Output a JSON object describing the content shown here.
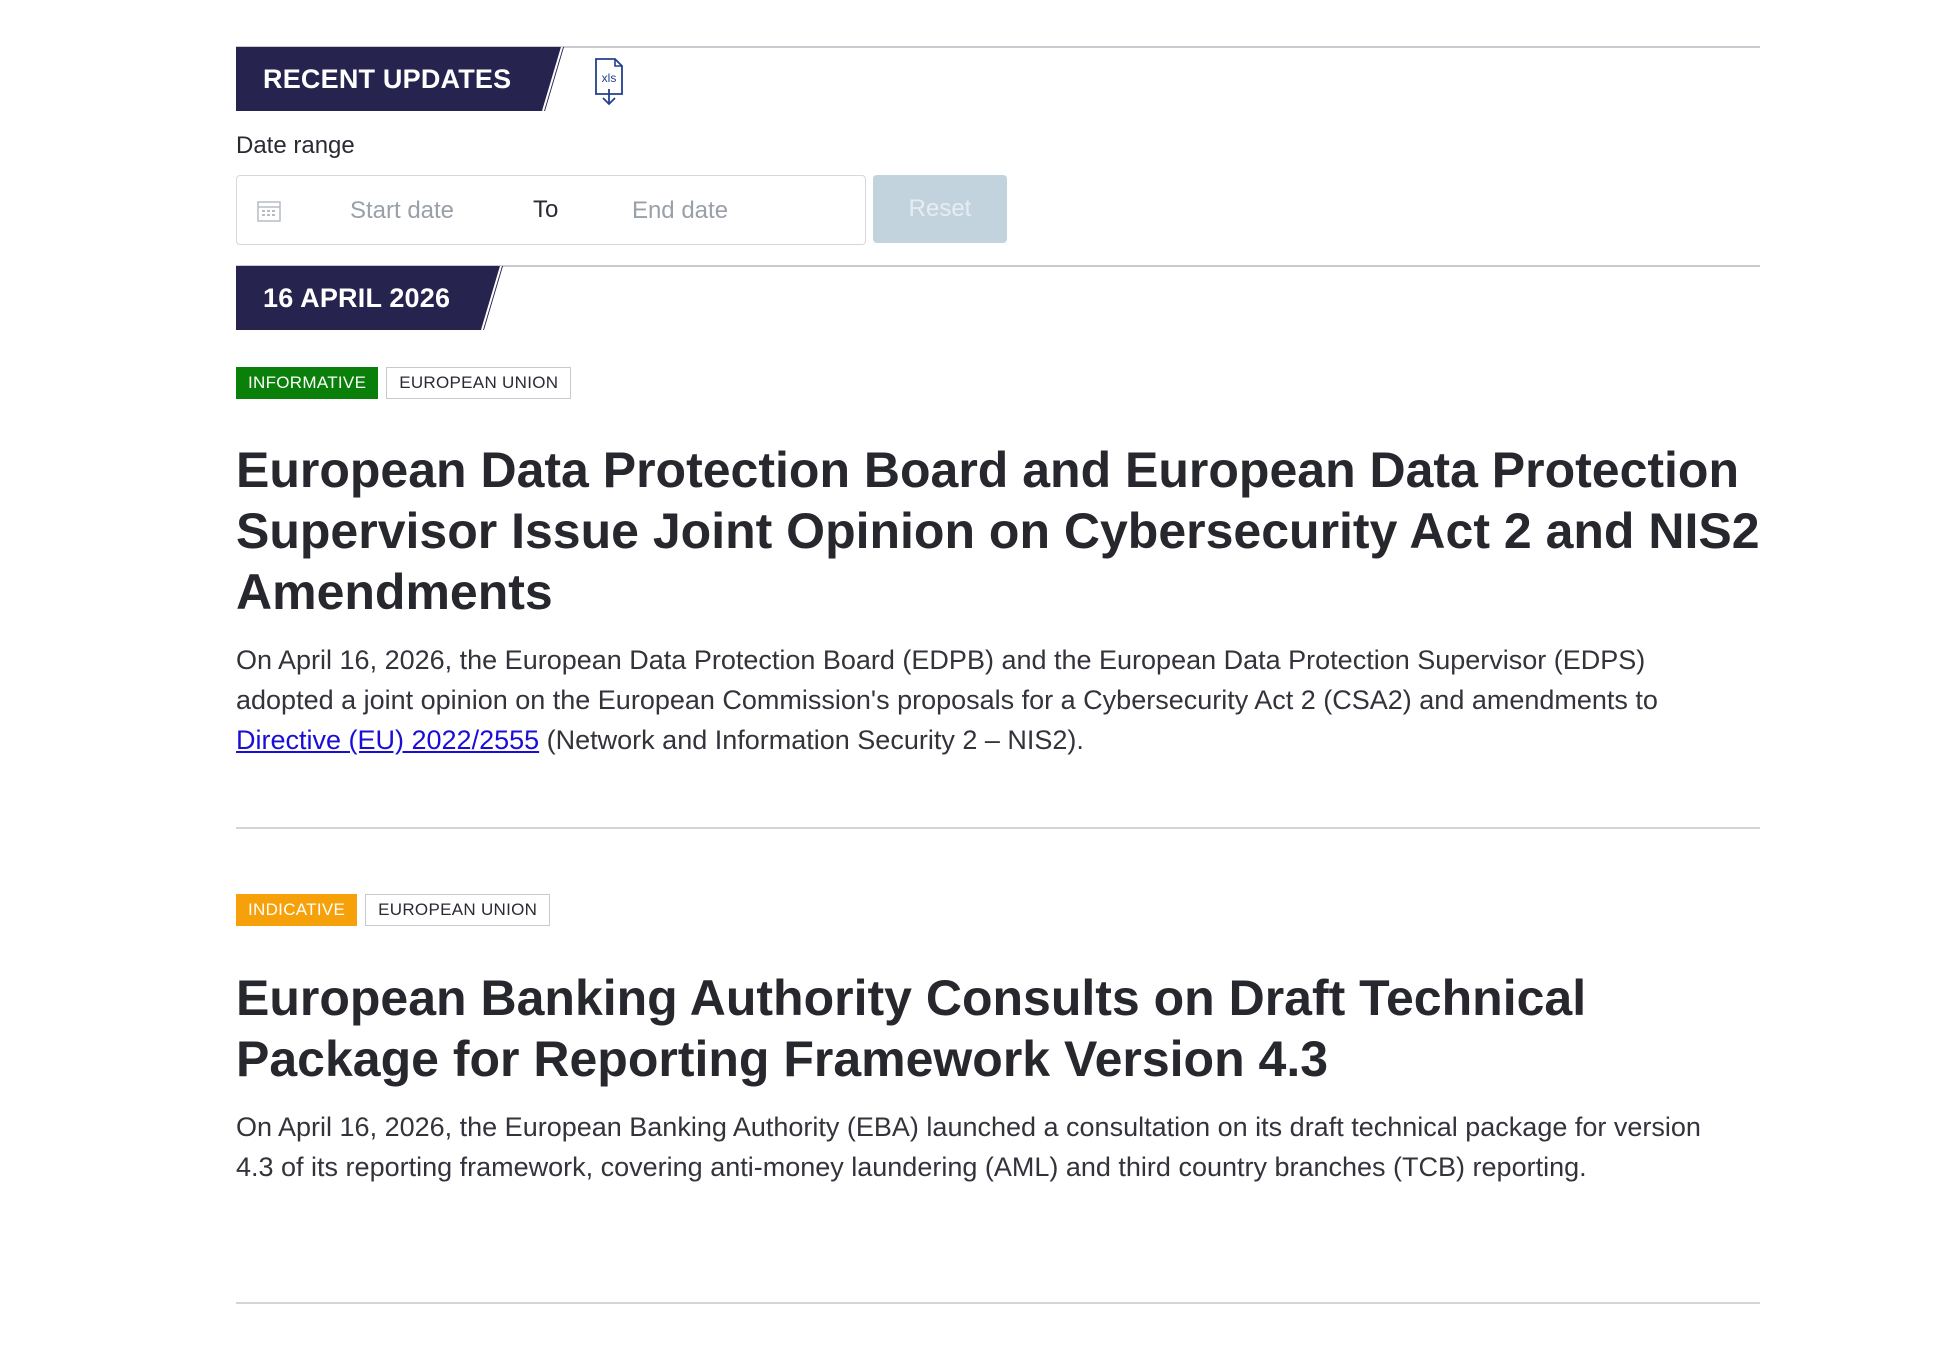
{
  "header": {
    "section_title": "RECENT UPDATES",
    "export_icon": "xls-download-icon",
    "export_icon_text": "xls"
  },
  "filters": {
    "date_range_label": "Date range",
    "start_placeholder": "Start date",
    "separator": "To",
    "end_placeholder": "End date",
    "reset_label": "Reset",
    "calendar_icon": "calendar-icon"
  },
  "date_group": {
    "label": "16 APRIL 2026"
  },
  "articles": [
    {
      "badges": [
        {
          "label": "INFORMATIVE",
          "color": "#0a7f0a"
        },
        {
          "label": "EUROPEAN UNION"
        }
      ],
      "title": "European Data Protection Board and European Data Protection Supervisor Issue Joint Opinion on Cybersecurity Act 2 and NIS2 Amendments",
      "summary_before_link": "On April 16, 2026, the European Data Protection Board (EDPB) and the European Data Protection Supervisor (EDPS) adopted a joint opinion on the European Commission's proposals for a Cybersecurity Act 2 (CSA2) and amendments to ",
      "summary_link": "Directive (EU) 2022/2555",
      "summary_after_link": " (Network and Information Security 2 – NIS2)."
    },
    {
      "badges": [
        {
          "label": "INDICATIVE",
          "color": "#f6a10a"
        },
        {
          "label": "EUROPEAN UNION"
        }
      ],
      "title": "European Banking Authority Consults on Draft Technical Package for Reporting Framework Version 4.3",
      "summary": "On April 16, 2026, the European Banking Authority (EBA) launched a consultation on its draft technical package for version 4.3 of its reporting framework, covering anti-money laundering (AML) and third country branches (TCB) reporting."
    }
  ],
  "colors": {
    "tag_background": "#27234f",
    "link": "#1a0dd6",
    "reset_disabled": "#c3d3de"
  }
}
